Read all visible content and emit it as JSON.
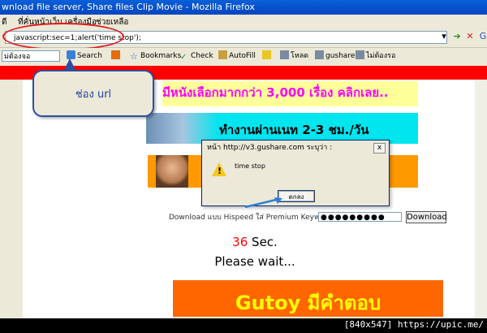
{
  "window": {
    "title": "wnload file server, Share files Clip Movie - Mozilla Firefox"
  },
  "menubar": {
    "items": [
      "ดี",
      "ที่คั่นหน้าเว็บ",
      "เครื่องมือ",
      "ช่วยเหลือ"
    ]
  },
  "addressbar": {
    "url": "javascript:sec=1;alert('time stop');"
  },
  "toolbar": {
    "search_placeholder": "ม่ต้องจอ",
    "search_label": "Search",
    "bookmarks_label": "Bookmarks",
    "check_label": "Check",
    "autofill_label": "AutoFill",
    "item1_label": "โหลด",
    "item2_label": "gushare",
    "item3_label": "ไม่ต้องรอ"
  },
  "annotation": {
    "callout_text": "ช่อง url"
  },
  "banners": {
    "banner1_text": "มีหนังเลือกมากกว่า 3,000 เรื่อง คลิกเลย..",
    "banner2_text": "ทำงานผ่านเนท 2-3 ชม./วัน",
    "banner_bottom_text": "Gutoy มีคำตอบ"
  },
  "dialog": {
    "title": "หน้า http://v3.gushare.com ระบุว่า :",
    "message": "time stop",
    "ok_label": "ตกลง",
    "close_label": "x"
  },
  "download": {
    "prefix_text": "Download แบบ Hispeed ใส่ Premium Keyword ที่นี่",
    "password_value": "●●●●●●●●●",
    "button_label": "Download"
  },
  "countdown": {
    "seconds": "36",
    "unit": "Sec.",
    "wait_text": "Please wait..."
  },
  "watermark": {
    "text": "[840x547] https://upic.me/"
  },
  "colors": {
    "red_bar": "#ff0000",
    "annotation_red": "#e0191c",
    "dialog_arrow": "#2f7fd8"
  }
}
